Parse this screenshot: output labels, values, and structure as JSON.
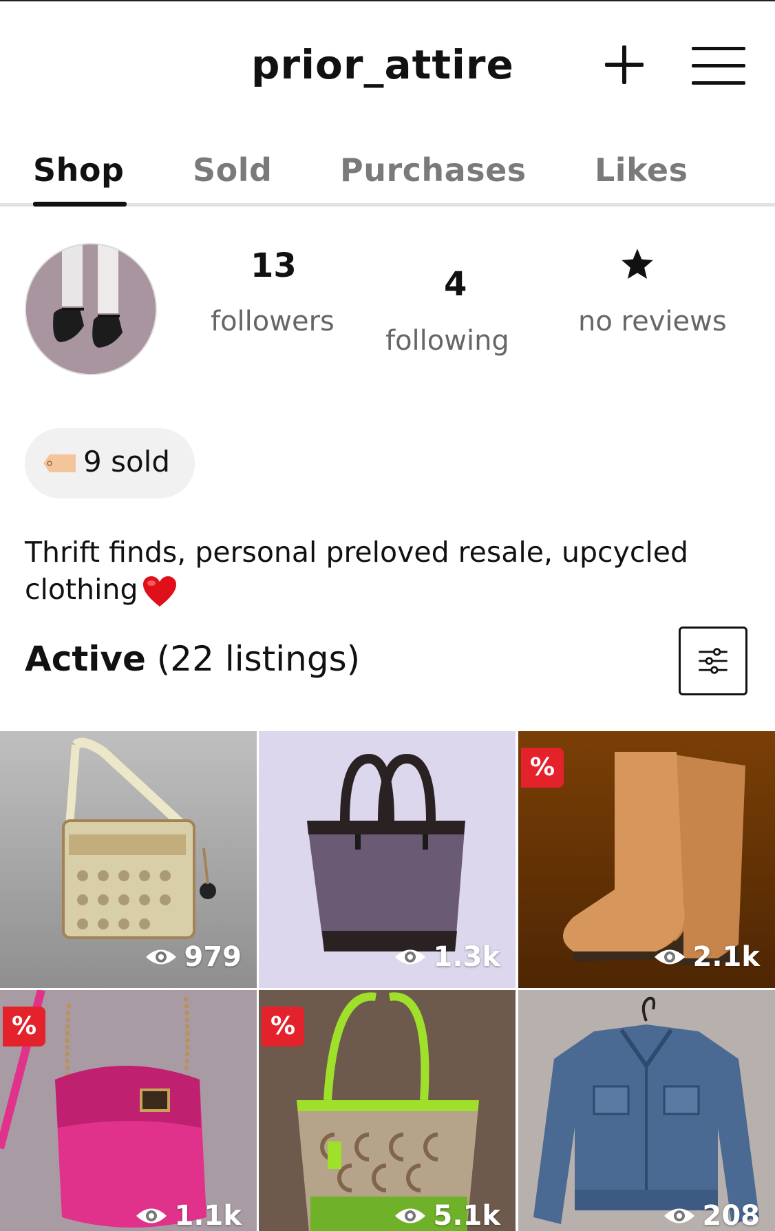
{
  "header": {
    "username": "prior_attire",
    "add_icon": "plus-icon",
    "menu_icon": "hamburger-menu-icon"
  },
  "tabs": [
    {
      "label": "Shop",
      "active": true
    },
    {
      "label": "Sold",
      "active": false
    },
    {
      "label": "Purchases",
      "active": false
    },
    {
      "label": "Likes",
      "active": false
    }
  ],
  "profile": {
    "followers_count": "13",
    "followers_label": "followers",
    "following_count": "4",
    "following_label": "following",
    "reviews_icon": "star-icon",
    "reviews_label": "no reviews",
    "sold_label": "9 sold",
    "bio": "Thrift finds, personal preloved resale, upcycled clothing"
  },
  "listings_header": {
    "title": "Active",
    "count_text": "(22 listings)"
  },
  "listings": [
    {
      "item": "beige monogram crossbody bag",
      "views": "979",
      "discount": false
    },
    {
      "item": "purple tweed tote bag",
      "views": "1.3k",
      "discount": false
    },
    {
      "item": "tan suede boots",
      "views": "2.1k",
      "discount": true,
      "discount_label": "%"
    },
    {
      "item": "pink leather crossbody bag",
      "views": "1.1k",
      "discount": true,
      "discount_label": "%"
    },
    {
      "item": "green trim signature tote",
      "views": "5.1k",
      "discount": true,
      "discount_label": "%"
    },
    {
      "item": "denim jacket",
      "views": "208",
      "discount": false
    }
  ],
  "colors": {
    "text_primary": "#111111",
    "text_muted": "#7a7a7a",
    "discount_badge": "#e3222c",
    "pill_bg": "#f1f1f1"
  }
}
